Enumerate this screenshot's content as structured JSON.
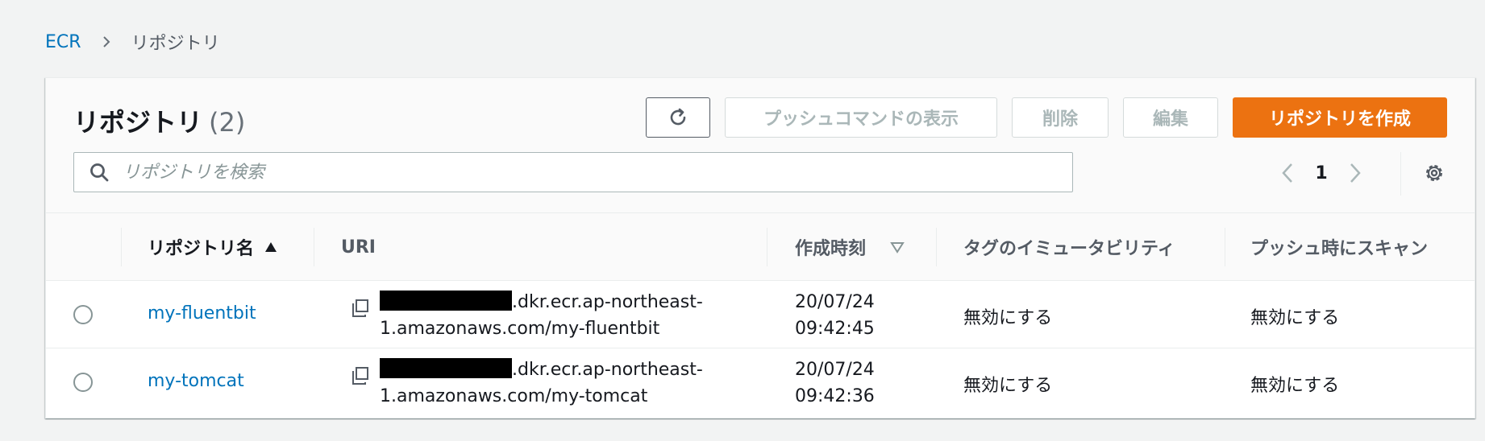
{
  "breadcrumb": {
    "root": "ECR",
    "current": "リポジトリ"
  },
  "panel": {
    "title": "リポジトリ",
    "count": "(2)"
  },
  "toolbar": {
    "push_commands": "プッシュコマンドの表示",
    "delete": "削除",
    "edit": "編集",
    "create": "リポジトリを作成"
  },
  "search": {
    "placeholder": "リポジトリを検索"
  },
  "pagination": {
    "page": "1"
  },
  "table": {
    "headers": {
      "name": "リポジトリ名",
      "uri": "URI",
      "created": "作成時刻",
      "immutability": "タグのイミュータビリティ",
      "scan": "プッシュ時にスキャン"
    },
    "rows": [
      {
        "name": "my-fluentbit",
        "uri_line1": ".dkr.ecr.ap-northeast-",
        "uri_line2": "1.amazonaws.com/my-fluentbit",
        "created_date": "20/07/24",
        "created_time": "09:42:45",
        "immutability": "無効にする",
        "scan": "無効にする"
      },
      {
        "name": "my-tomcat",
        "uri_line1": ".dkr.ecr.ap-northeast-",
        "uri_line2": "1.amazonaws.com/my-tomcat",
        "created_date": "20/07/24",
        "created_time": "09:42:36",
        "immutability": "無効にする",
        "scan": "無効にする"
      }
    ]
  },
  "colors": {
    "link": "#0073bb",
    "primary_button": "#ec7211",
    "disabled_text": "#aab7b8"
  }
}
